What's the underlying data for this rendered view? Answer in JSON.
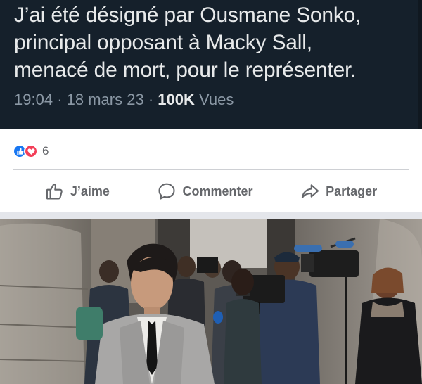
{
  "tweet": {
    "lines": [
      "J’ai été désigné par Ousmane Sonko,",
      "principal opposant à Macky Sall,",
      "menacé de mort, pour le représenter."
    ],
    "time": "19:04",
    "date": "18 mars 23",
    "views_count": "100K",
    "views_label": "Vues"
  },
  "reactions": {
    "icons": [
      "like-icon",
      "love-icon"
    ],
    "count": "6"
  },
  "actions": {
    "like_label": "J’aime",
    "comment_label": "Commenter",
    "share_label": "Partager"
  },
  "colors": {
    "tweet_bg": "#15202b",
    "like_blue": "#1877f2",
    "love_red": "#f33e58",
    "action_gray": "#65676b"
  }
}
